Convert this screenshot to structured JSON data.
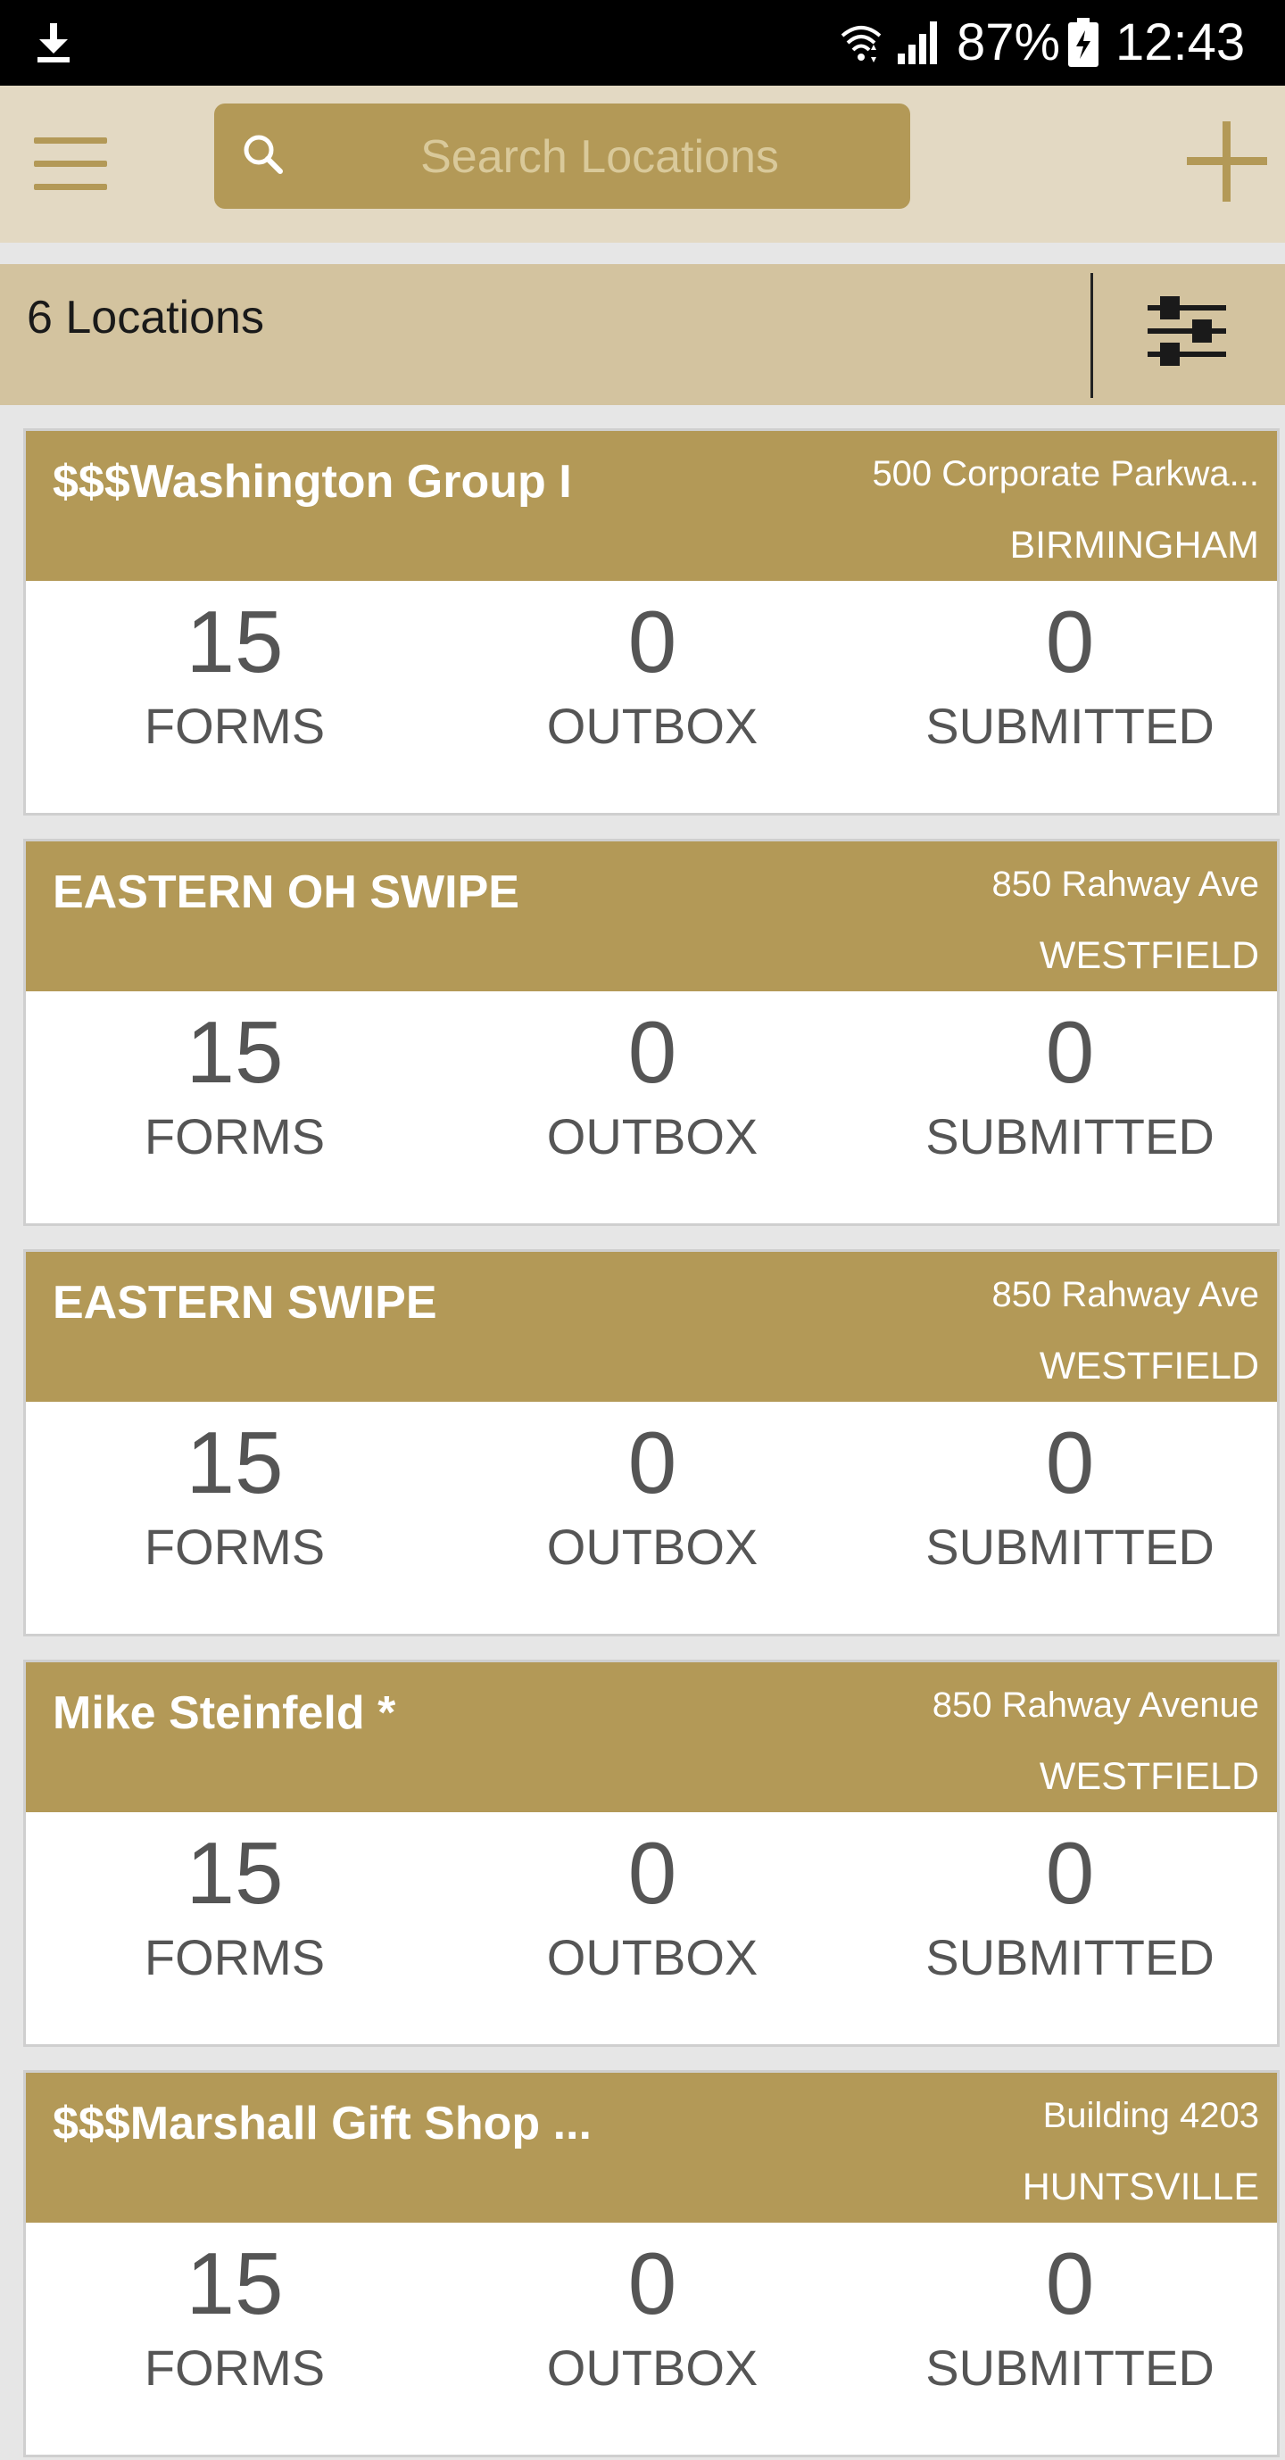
{
  "status_bar": {
    "battery_percent": "87%",
    "time": "12:43",
    "icons": [
      "download-icon",
      "wifi-icon",
      "signal-icon",
      "battery-charging-icon"
    ]
  },
  "toolbar": {
    "search_placeholder": "Search Locations",
    "icons": [
      "hamburger-menu-icon",
      "search-icon",
      "plus-icon"
    ]
  },
  "summary": {
    "count_label": "6 Locations",
    "filter_icon": "sliders-filter-icon"
  },
  "stat_labels": {
    "forms": "FORMS",
    "outbox": "OUTBOX",
    "submitted": "SUBMITTED"
  },
  "locations": [
    {
      "name": "$$$Washington Group I",
      "address": "500 Corporate Parkwa...",
      "city": "BIRMINGHAM",
      "forms": "15",
      "outbox": "0",
      "submitted": "0"
    },
    {
      "name": "EASTERN OH SWIPE",
      "address": "850 Rahway Ave",
      "city": "WESTFIELD",
      "forms": "15",
      "outbox": "0",
      "submitted": "0"
    },
    {
      "name": "EASTERN SWIPE",
      "address": "850 Rahway Ave",
      "city": "WESTFIELD",
      "forms": "15",
      "outbox": "0",
      "submitted": "0"
    },
    {
      "name": "Mike Steinfeld *",
      "address": "850 Rahway Avenue",
      "city": "WESTFIELD",
      "forms": "15",
      "outbox": "0",
      "submitted": "0"
    },
    {
      "name": "$$$Marshall Gift Shop ...",
      "address": "Building 4203",
      "city": "HUNTSVILLE",
      "forms": "15",
      "outbox": "0",
      "submitted": "0"
    }
  ],
  "colors": {
    "accent": "#b39957",
    "toolbar_bg": "#e3d9c3",
    "count_bar_bg": "#d3c39f",
    "page_bg": "#e6e6e6",
    "stat_text": "#555555"
  }
}
